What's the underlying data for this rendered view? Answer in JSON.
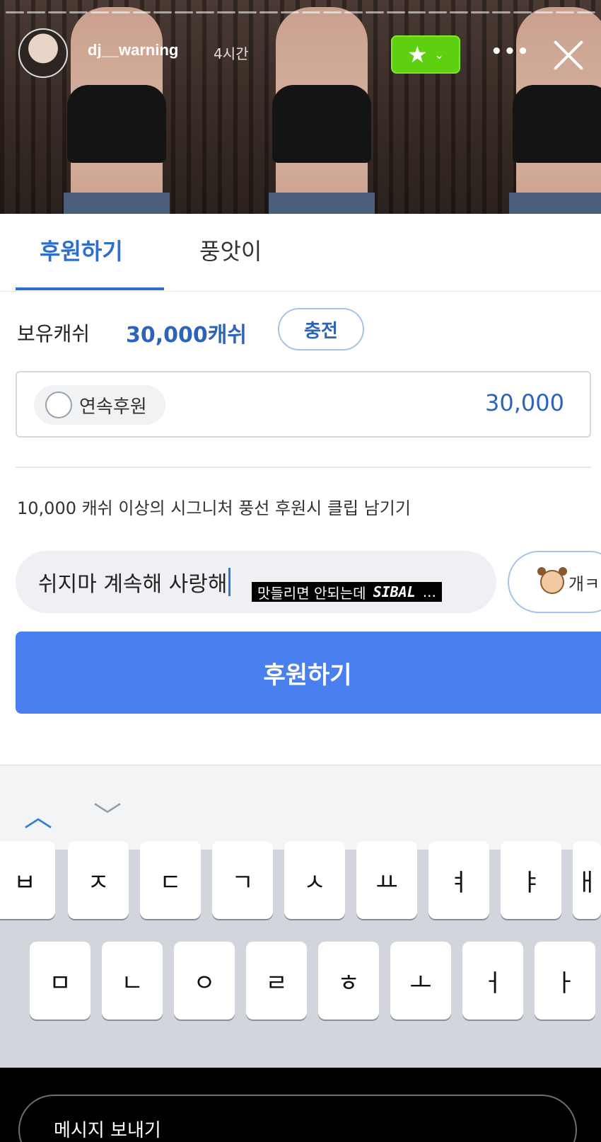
{
  "story": {
    "username": "dj__warning",
    "time": "4시간",
    "more_label": "•••",
    "fav_star": "★",
    "fav_chevron": "⌄"
  },
  "tabs": [
    {
      "label": "후원하기"
    },
    {
      "label": "풍앗이"
    }
  ],
  "cash": {
    "label": "보유캐쉬",
    "value": "30,000캐쉬",
    "charge_label": "충전"
  },
  "amount": {
    "continuous_label": "연속후원",
    "value": "30,000"
  },
  "notice": "10,000 캐쉬 이상의 시그니처 풍선 후원시 클립 남기기",
  "message": {
    "value": "쉬지마 계속해 사랑해",
    "emoticon_label": "개ㅋ"
  },
  "caption": {
    "text": "맛들리면  안되는데",
    "emphasis": "SIBAL",
    "trail": "..."
  },
  "donate_button": "후원하기",
  "toolbar": {
    "up": "︿",
    "down": "﹀"
  },
  "keyboard": {
    "row1": [
      "ㅂ",
      "ㅈ",
      "ㄷ",
      "ㄱ",
      "ㅅ",
      "ㅛ",
      "ㅕ",
      "ㅑ",
      "ㅐ"
    ],
    "row2": [
      "ㅁ",
      "ㄴ",
      "ㅇ",
      "ㄹ",
      "ㅎ",
      "ㅗ",
      "ㅓ",
      "ㅏ"
    ]
  },
  "bottom": {
    "send_message_placeholder": "메시지 보내기"
  }
}
